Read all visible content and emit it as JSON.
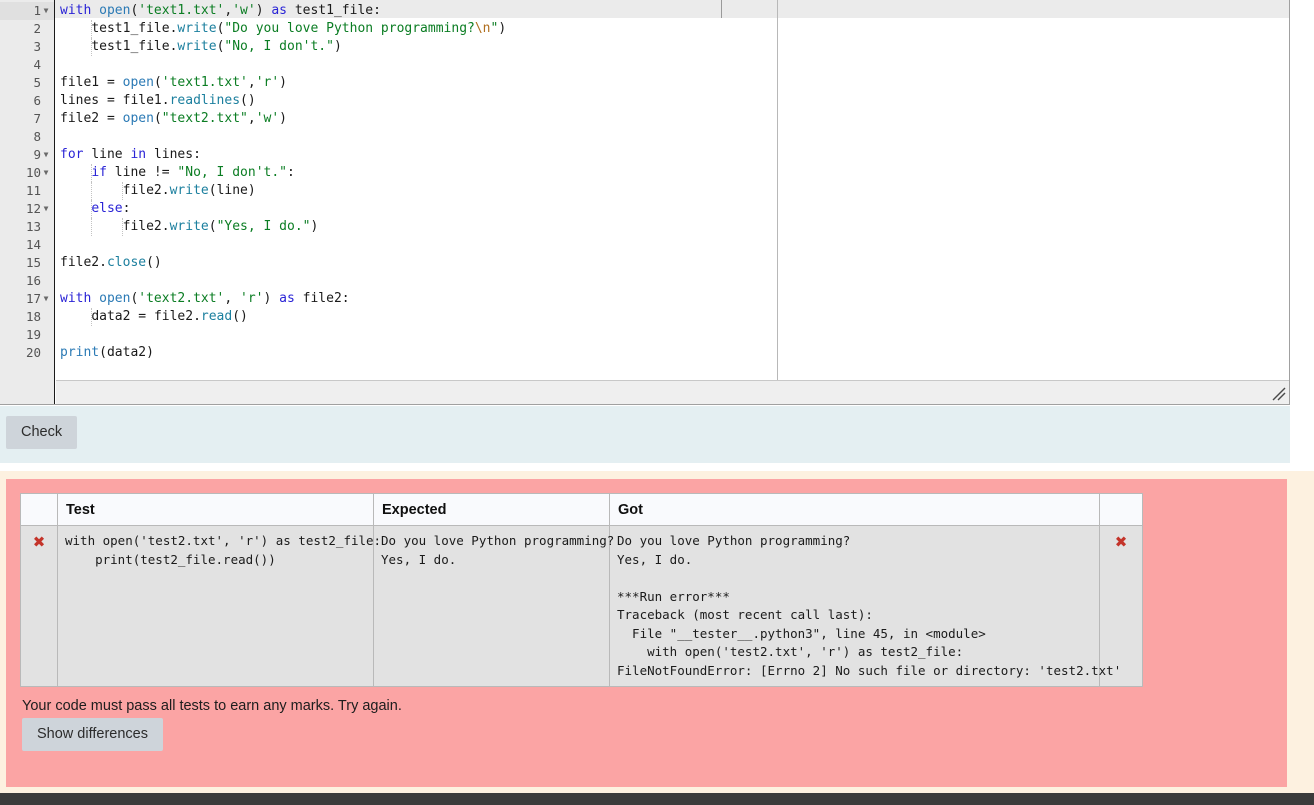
{
  "editor": {
    "name": "python-code-editor",
    "language": "python",
    "line_count": 20,
    "lines": [
      {
        "n": 1,
        "fold": true,
        "text": "with open('text1.txt','w') as test1_file:"
      },
      {
        "n": 2,
        "fold": false,
        "text": "    test1_file.write(\"Do you love Python programming?\\n\")"
      },
      {
        "n": 3,
        "fold": false,
        "text": "    test1_file.write(\"No, I don't.\")"
      },
      {
        "n": 4,
        "fold": false,
        "text": ""
      },
      {
        "n": 5,
        "fold": false,
        "text": "file1 = open('text1.txt','r')"
      },
      {
        "n": 6,
        "fold": false,
        "text": "lines = file1.readlines()"
      },
      {
        "n": 7,
        "fold": false,
        "text": "file2 = open(\"text2.txt\",'w')"
      },
      {
        "n": 8,
        "fold": false,
        "text": ""
      },
      {
        "n": 9,
        "fold": true,
        "text": "for line in lines:"
      },
      {
        "n": 10,
        "fold": true,
        "text": "    if line != \"No, I don't.\":"
      },
      {
        "n": 11,
        "fold": false,
        "text": "        file2.write(line)"
      },
      {
        "n": 12,
        "fold": true,
        "text": "    else:"
      },
      {
        "n": 13,
        "fold": false,
        "text": "        file2.write(\"Yes, I do.\")"
      },
      {
        "n": 14,
        "fold": false,
        "text": ""
      },
      {
        "n": 15,
        "fold": false,
        "text": "file2.close()"
      },
      {
        "n": 16,
        "fold": false,
        "text": ""
      },
      {
        "n": 17,
        "fold": true,
        "text": "with open('text2.txt', 'r') as file2:"
      },
      {
        "n": 18,
        "fold": false,
        "text": "    data2 = file2.read()"
      },
      {
        "n": 19,
        "fold": false,
        "text": ""
      },
      {
        "n": 20,
        "fold": false,
        "text": "print(data2)"
      }
    ],
    "resize_handle_icon": "resize-grip-icon"
  },
  "toolbar": {
    "check_label": "Check"
  },
  "results": {
    "columns": [
      "",
      "Test",
      "Expected",
      "Got",
      ""
    ],
    "rows": [
      {
        "mark_icon": "cross-mark-icon",
        "test": "with open('test2.txt', 'r') as test2_file:\n    print(test2_file.read())",
        "expected": "Do you love Python programming?\nYes, I do.",
        "got": "Do you love Python programming?\nYes, I do.\n\n***Run error***\nTraceback (most recent call last):\n  File \"__tester__.python3\", line 45, in <module>\n    with open('test2.txt', 'r') as test2_file:\nFileNotFoundError: [Errno 2] No such file or directory: 'test2.txt'",
        "result_icon": "cross-mark-icon"
      }
    ],
    "cross_glyph": "✖",
    "message": "Your code must pass all tests to earn any marks. Try again.",
    "show_differences_label": "Show differences"
  },
  "colors": {
    "fail_background": "#fba4a4",
    "fail_wrapper": "#fdf1e0",
    "check_band": "#e4eff2",
    "cross": "#c4342a",
    "keyword": "#2a24d6",
    "string": "#0b7d23",
    "builtin": "#2b7ab5",
    "property": "#1b7f9e",
    "escape": "#b06f1f"
  }
}
